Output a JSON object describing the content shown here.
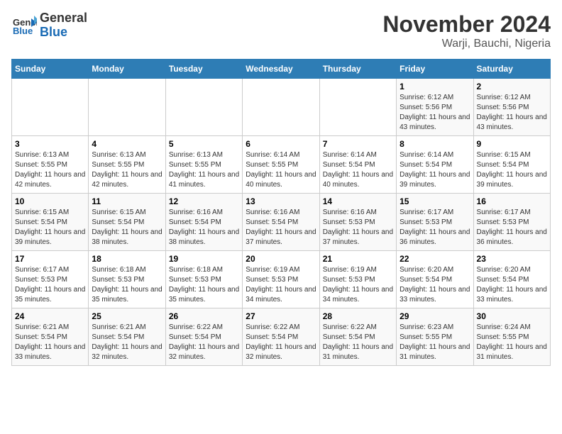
{
  "header": {
    "logo_line1": "General",
    "logo_line2": "Blue",
    "month_title": "November 2024",
    "location": "Warji, Bauchi, Nigeria"
  },
  "calendar": {
    "days_of_week": [
      "Sunday",
      "Monday",
      "Tuesday",
      "Wednesday",
      "Thursday",
      "Friday",
      "Saturday"
    ],
    "weeks": [
      [
        {
          "day": "",
          "info": ""
        },
        {
          "day": "",
          "info": ""
        },
        {
          "day": "",
          "info": ""
        },
        {
          "day": "",
          "info": ""
        },
        {
          "day": "",
          "info": ""
        },
        {
          "day": "1",
          "info": "Sunrise: 6:12 AM\nSunset: 5:56 PM\nDaylight: 11 hours and 43 minutes."
        },
        {
          "day": "2",
          "info": "Sunrise: 6:12 AM\nSunset: 5:56 PM\nDaylight: 11 hours and 43 minutes."
        }
      ],
      [
        {
          "day": "3",
          "info": "Sunrise: 6:13 AM\nSunset: 5:55 PM\nDaylight: 11 hours and 42 minutes."
        },
        {
          "day": "4",
          "info": "Sunrise: 6:13 AM\nSunset: 5:55 PM\nDaylight: 11 hours and 42 minutes."
        },
        {
          "day": "5",
          "info": "Sunrise: 6:13 AM\nSunset: 5:55 PM\nDaylight: 11 hours and 41 minutes."
        },
        {
          "day": "6",
          "info": "Sunrise: 6:14 AM\nSunset: 5:55 PM\nDaylight: 11 hours and 40 minutes."
        },
        {
          "day": "7",
          "info": "Sunrise: 6:14 AM\nSunset: 5:54 PM\nDaylight: 11 hours and 40 minutes."
        },
        {
          "day": "8",
          "info": "Sunrise: 6:14 AM\nSunset: 5:54 PM\nDaylight: 11 hours and 39 minutes."
        },
        {
          "day": "9",
          "info": "Sunrise: 6:15 AM\nSunset: 5:54 PM\nDaylight: 11 hours and 39 minutes."
        }
      ],
      [
        {
          "day": "10",
          "info": "Sunrise: 6:15 AM\nSunset: 5:54 PM\nDaylight: 11 hours and 39 minutes."
        },
        {
          "day": "11",
          "info": "Sunrise: 6:15 AM\nSunset: 5:54 PM\nDaylight: 11 hours and 38 minutes."
        },
        {
          "day": "12",
          "info": "Sunrise: 6:16 AM\nSunset: 5:54 PM\nDaylight: 11 hours and 38 minutes."
        },
        {
          "day": "13",
          "info": "Sunrise: 6:16 AM\nSunset: 5:54 PM\nDaylight: 11 hours and 37 minutes."
        },
        {
          "day": "14",
          "info": "Sunrise: 6:16 AM\nSunset: 5:53 PM\nDaylight: 11 hours and 37 minutes."
        },
        {
          "day": "15",
          "info": "Sunrise: 6:17 AM\nSunset: 5:53 PM\nDaylight: 11 hours and 36 minutes."
        },
        {
          "day": "16",
          "info": "Sunrise: 6:17 AM\nSunset: 5:53 PM\nDaylight: 11 hours and 36 minutes."
        }
      ],
      [
        {
          "day": "17",
          "info": "Sunrise: 6:17 AM\nSunset: 5:53 PM\nDaylight: 11 hours and 35 minutes."
        },
        {
          "day": "18",
          "info": "Sunrise: 6:18 AM\nSunset: 5:53 PM\nDaylight: 11 hours and 35 minutes."
        },
        {
          "day": "19",
          "info": "Sunrise: 6:18 AM\nSunset: 5:53 PM\nDaylight: 11 hours and 35 minutes."
        },
        {
          "day": "20",
          "info": "Sunrise: 6:19 AM\nSunset: 5:53 PM\nDaylight: 11 hours and 34 minutes."
        },
        {
          "day": "21",
          "info": "Sunrise: 6:19 AM\nSunset: 5:53 PM\nDaylight: 11 hours and 34 minutes."
        },
        {
          "day": "22",
          "info": "Sunrise: 6:20 AM\nSunset: 5:54 PM\nDaylight: 11 hours and 33 minutes."
        },
        {
          "day": "23",
          "info": "Sunrise: 6:20 AM\nSunset: 5:54 PM\nDaylight: 11 hours and 33 minutes."
        }
      ],
      [
        {
          "day": "24",
          "info": "Sunrise: 6:21 AM\nSunset: 5:54 PM\nDaylight: 11 hours and 33 minutes."
        },
        {
          "day": "25",
          "info": "Sunrise: 6:21 AM\nSunset: 5:54 PM\nDaylight: 11 hours and 32 minutes."
        },
        {
          "day": "26",
          "info": "Sunrise: 6:22 AM\nSunset: 5:54 PM\nDaylight: 11 hours and 32 minutes."
        },
        {
          "day": "27",
          "info": "Sunrise: 6:22 AM\nSunset: 5:54 PM\nDaylight: 11 hours and 32 minutes."
        },
        {
          "day": "28",
          "info": "Sunrise: 6:22 AM\nSunset: 5:54 PM\nDaylight: 11 hours and 31 minutes."
        },
        {
          "day": "29",
          "info": "Sunrise: 6:23 AM\nSunset: 5:55 PM\nDaylight: 11 hours and 31 minutes."
        },
        {
          "day": "30",
          "info": "Sunrise: 6:24 AM\nSunset: 5:55 PM\nDaylight: 11 hours and 31 minutes."
        }
      ]
    ]
  }
}
